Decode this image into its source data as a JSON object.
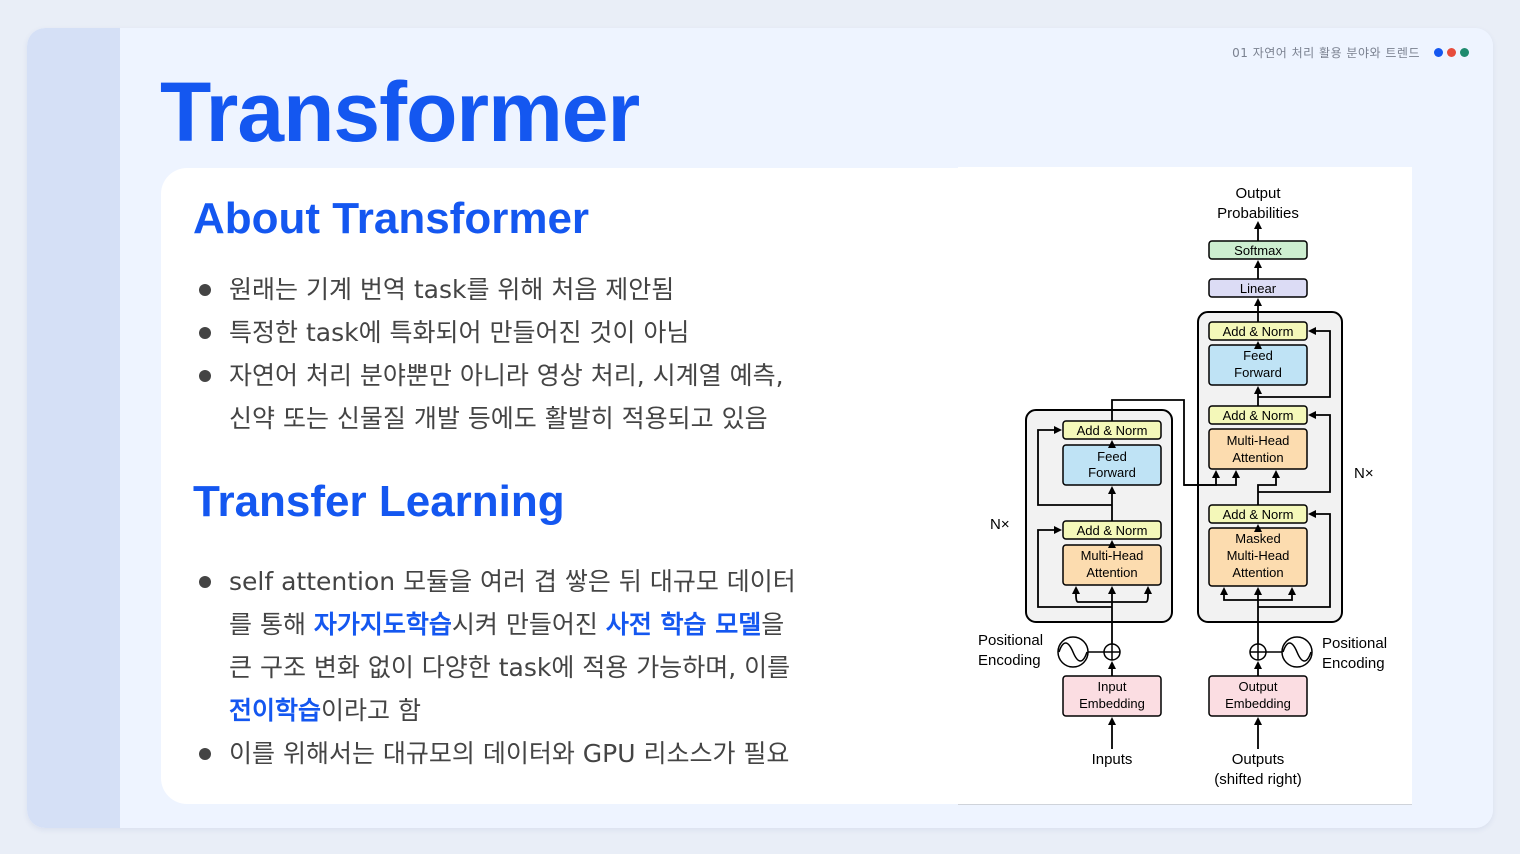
{
  "header": {
    "section_label": "01  자연어 처리 활용 분야와 트렌드",
    "dot_colors": [
      "#1457f0",
      "#e74c3c",
      "#1e8a6e"
    ]
  },
  "title": "Transformer",
  "about": {
    "title": "About Transformer",
    "bullets": [
      {
        "text": "원래는 기계 번역 task를 위해 처음 제안됨"
      },
      {
        "text": "특정한 task에 특화되어 만들어진 것이 아님"
      },
      {
        "line1": "자연어 처리 분야뿐만 아니라 영상 처리, 시계열 예측,",
        "line2": "신약 또는 신물질 개발 등에도 활발히 적용되고 있음"
      }
    ]
  },
  "transfer": {
    "title": "Transfer Learning",
    "bullet1": {
      "l1": "self attention 모듈을 여러 겹 쌓은 뒤 대규모 데이터",
      "l2a": "를 통해 ",
      "l2b": "자가지도학습",
      "l2c": "시켜 만들어진 ",
      "l2d": "사전 학습 모델",
      "l2e": "을",
      "l3": "큰 구조 변화 없이 다양한 task에 적용 가능하며, 이를",
      "l4a": "전이학습",
      "l4b": "이라고 함"
    },
    "bullet2": "이를 위해서는 대규모의 데이터와 GPU 리소스가 필요"
  },
  "diagram": {
    "output_probabilities": [
      "Output",
      "Probabilities"
    ],
    "softmax": "Softmax",
    "linear": "Linear",
    "add_norm": "Add & Norm",
    "feed_forward": [
      "Feed",
      "Forward"
    ],
    "multi_head_attention": [
      "Multi-Head",
      "Attention"
    ],
    "masked_multi_head_attention": [
      "Masked",
      "Multi-Head",
      "Attention"
    ],
    "nx": "N×",
    "positional_encoding": [
      "Positional",
      "Encoding"
    ],
    "input_embedding": [
      "Input",
      "Embedding"
    ],
    "output_embedding": [
      "Output",
      "Embedding"
    ],
    "inputs": "Inputs",
    "outputs": [
      "Outputs",
      "(shifted right)"
    ],
    "colors": {
      "add_norm": "#f4f8b9",
      "feed_forward": "#bfe3f5",
      "attention": "#fcdcaf",
      "embedding": "#fbdde2",
      "softmax": "#cdeed0",
      "linear": "#dcdcf5",
      "stack_bg": "#f2f2f2"
    }
  }
}
